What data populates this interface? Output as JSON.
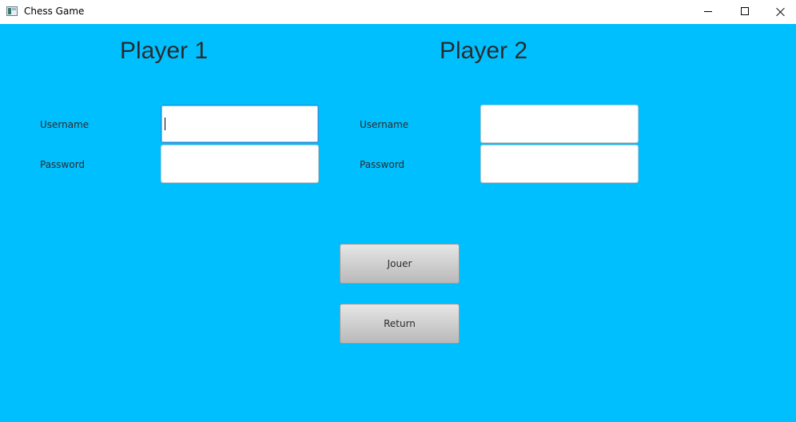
{
  "window": {
    "title": "Chess Game",
    "app_icon": "chess-app-icon",
    "controls": [
      "minimize-icon",
      "maximize-icon",
      "close-icon"
    ]
  },
  "colors": {
    "background": "#00bfff",
    "title_text": "#2b2b2b",
    "input_focus_border": "#1e8fd8",
    "button_gradient_top": "#e6e6e6",
    "button_gradient_bottom": "#b9b9b9"
  },
  "player1": {
    "title": "Player 1",
    "username_label": "Username",
    "password_label": "Password",
    "username_value": "",
    "password_value": ""
  },
  "player2": {
    "title": "Player 2",
    "username_label": "Username",
    "password_label": "Password",
    "username_value": "",
    "password_value": ""
  },
  "buttons": {
    "play_label": "Jouer",
    "return_label": "Return"
  }
}
